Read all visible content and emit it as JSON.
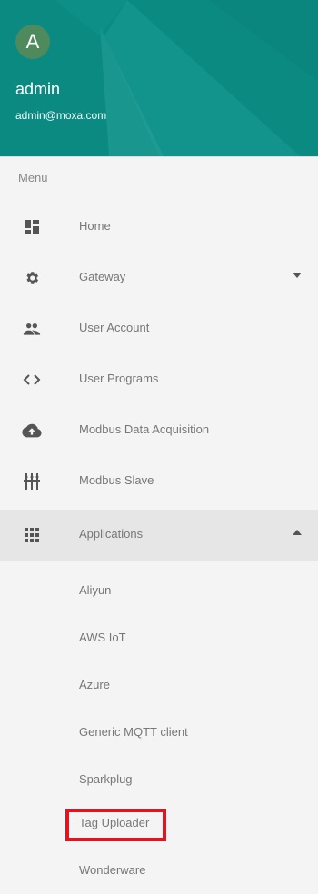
{
  "header": {
    "avatar_letter": "A",
    "username": "admin",
    "email": "admin@moxa.com",
    "brand_color": "#0b8a82"
  },
  "menu": {
    "title": "Menu",
    "items": [
      {
        "label": "Home",
        "icon": "dashboard-icon"
      },
      {
        "label": "Gateway",
        "icon": "gear-icon"
      },
      {
        "label": "User Account",
        "icon": "people-icon"
      },
      {
        "label": "User Programs",
        "icon": "code-icon"
      },
      {
        "label": "Modbus Data Acquisition",
        "icon": "cloud-upload-icon"
      },
      {
        "label": "Modbus Slave",
        "icon": "network-icon"
      },
      {
        "label": "Applications",
        "icon": "grid-icon"
      }
    ],
    "applications_children": [
      {
        "label": "Aliyun"
      },
      {
        "label": "AWS IoT"
      },
      {
        "label": "Azure"
      },
      {
        "label": "Generic MQTT client"
      },
      {
        "label": "Sparkplug"
      },
      {
        "label": "Tag Uploader"
      },
      {
        "label": "Wonderware"
      }
    ]
  },
  "highlight_color": "#e0151f"
}
